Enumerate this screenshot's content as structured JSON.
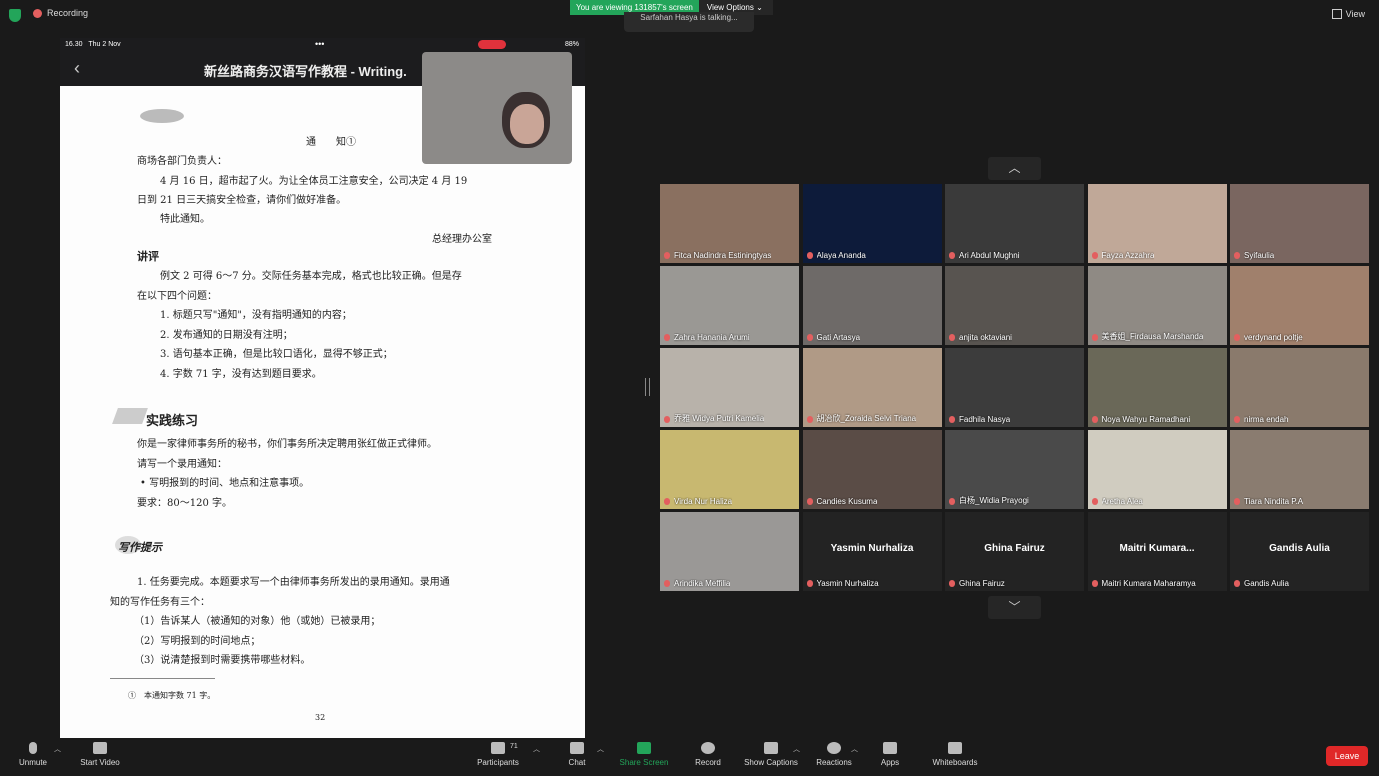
{
  "top": {
    "recording": "Recording",
    "viewing_banner": "You are viewing 131857's screen",
    "view_options": "View Options",
    "talking": "Sarfahan Hasya is talking...",
    "view": "View"
  },
  "ipad": {
    "time": "16.30",
    "date": "Thu 2 Nov",
    "battery": "88%",
    "title": "新丝路商务汉语写作教程 - Writing."
  },
  "doc": {
    "example_tag": "例文5",
    "notice_title": "通　　知①",
    "addressee": "商场各部门负责人：",
    "body1": "4 月 16 日，超市起了火。为让全体员工注意安全，公司决定 4 月 19",
    "body2": "日到 21 日三天搞安全检查，请你们做好准备。",
    "body3": "特此通知。",
    "signature": "总经理办公室",
    "commentary_title": "讲评",
    "comment1": "例文 2 可得 6～7 分。交际任务基本完成，格式也比较正确。但是存",
    "comment2": "在以下四个问题：",
    "issues": [
      "1. 标题只写\"通知\"，没有指明通知的内容；",
      "2. 发布通知的日期没有注明；",
      "3. 语句基本正确，但是比较口语化，显得不够正式；",
      "4. 字数 71 字，没有达到题目要求。"
    ],
    "practice_title": "实践练习",
    "practice1": "你是一家律师事务所的秘书，你们事务所决定聘用张红做正式律师。",
    "practice2": "请写一个录用通知：",
    "practice3": "• 写明报到的时间、地点和注意事项。",
    "practice4": "要求：80～120 字。",
    "tips_title": "写作提示",
    "tip1": "1. 任务要完成。本题要求写一个由律师事务所发出的录用通知。录用通",
    "tip2": "知的写作任务有三个：",
    "tip_items": [
      "（1）告诉某人（被通知的对象）他（或她）已被录用；",
      "（2）写明报到的时间地点；",
      "（3）说清楚报到时需要携带哪些材料。"
    ],
    "footnote": "①　本通知字数 71 字。",
    "page_number": "32"
  },
  "participants": [
    {
      "name": "Fitca Nadindra Estiningtyas",
      "color": "#8a7060"
    },
    {
      "name": "Alaya Ananda",
      "color": "#0d1b3a"
    },
    {
      "name": "Ari Abdul Mughni",
      "color": "#3a3a3a"
    },
    {
      "name": "Fayza Azzahra",
      "color": "#c0a898"
    },
    {
      "name": "Syifaulia",
      "color": "#7a6660"
    },
    {
      "name": "Zahra Hanania Arumi",
      "color": "#9a9894"
    },
    {
      "name": "Gati Artasya",
      "color": "#6e6a68"
    },
    {
      "name": "anjita oktaviani",
      "color": "#585450"
    },
    {
      "name": "美香姐_Firdausa Marshanda",
      "color": "#8f8a84"
    },
    {
      "name": "verdynand poltje",
      "color": "#a0806c"
    },
    {
      "name": "乔雅 Widya Putri Kamelia",
      "color": "#b8b2aa"
    },
    {
      "name": "胡冶欣_Zoraida Selvi Triana",
      "color": "#b09a86"
    },
    {
      "name": "Fadhila Nasya",
      "color": "#3c3c3c"
    },
    {
      "name": "Noya Wahyu Ramadhani",
      "color": "#6a6858"
    },
    {
      "name": "nirma endah",
      "color": "#8a7a6c"
    },
    {
      "name": "Virda Nur Haliza",
      "color": "#c8b870"
    },
    {
      "name": "Candies Kusuma",
      "color": "#5a4c46"
    },
    {
      "name": "白杨_Widia Prayogi",
      "color": "#4a4a4a"
    },
    {
      "name": "Aretha Alea",
      "color": "#d0ccc0"
    },
    {
      "name": "Tiara Nindita P.A",
      "color": "#8a7c70"
    },
    {
      "name": "Arindika Meffilia",
      "color": "#9a9896"
    },
    {
      "name": "Yasmin Nurhaliza",
      "big": "Yasmin Nurhaliza",
      "color": "#232323"
    },
    {
      "name": "Ghina Fairuz",
      "big": "Ghina Fairuz",
      "color": "#232323"
    },
    {
      "name": "Maitri Kumara Maharamya",
      "big": "Maitri  Kumara...",
      "color": "#232323"
    },
    {
      "name": "Gandis Aulia",
      "big": "Gandis Aulia",
      "color": "#232323"
    }
  ],
  "toolbar": {
    "unmute": "Unmute",
    "start_video": "Start Video",
    "participants": "Participants",
    "participants_count": "71",
    "chat": "Chat",
    "share_screen": "Share Screen",
    "record": "Record",
    "show_captions": "Show Captions",
    "reactions": "Reactions",
    "apps": "Apps",
    "whiteboards": "Whiteboards",
    "leave": "Leave"
  }
}
